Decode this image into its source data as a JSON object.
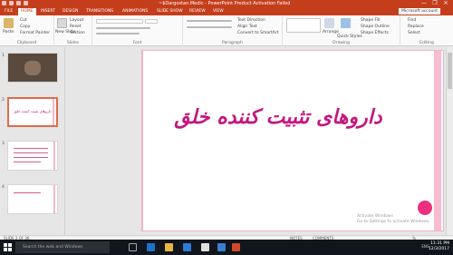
{
  "window": {
    "title": "~$Dargostan.Medic - PowerPoint Product Activation Failed",
    "controls": [
      "—",
      "❐",
      "✕"
    ]
  },
  "ribbon_tabs": [
    {
      "label": "FILE",
      "active": false
    },
    {
      "label": "HOME",
      "active": true
    },
    {
      "label": "INSERT",
      "active": false
    },
    {
      "label": "DESIGN",
      "active": false
    },
    {
      "label": "TRANSITIONS",
      "active": false
    },
    {
      "label": "ANIMATIONS",
      "active": false
    },
    {
      "label": "SLIDE SHOW",
      "active": false
    },
    {
      "label": "REVIEW",
      "active": false
    },
    {
      "label": "VIEW",
      "active": false
    }
  ],
  "account": "Microsoft account",
  "ribbon_groups": {
    "clipboard": {
      "label": "Clipboard",
      "items": [
        "Paste",
        "Cut",
        "Copy",
        "Format Painter"
      ]
    },
    "slides": {
      "label": "Slides",
      "items": [
        "New Slide",
        "Layout",
        "Reset",
        "Section"
      ]
    },
    "font": {
      "label": "Font"
    },
    "paragraph": {
      "label": "Paragraph",
      "items": [
        "Text Direction",
        "Align Text",
        "Convert to SmartArt"
      ]
    },
    "drawing": {
      "label": "Drawing",
      "items": [
        "Arrange",
        "Quick Styles",
        "Shape Fill",
        "Shape Outline",
        "Shape Effects"
      ]
    },
    "editing": {
      "label": "Editing",
      "items": [
        "Find",
        "Replace",
        "Select"
      ]
    }
  },
  "thumbnails": [
    {
      "num": "1"
    },
    {
      "num": "2",
      "text": "داروهای تثبیت کننده خلق"
    },
    {
      "num": "3"
    },
    {
      "num": "4"
    }
  ],
  "slide": {
    "title": "داروهای تثبیت کننده خلق"
  },
  "watermark": {
    "line1": "Activate Windows",
    "line2": "Go to Settings to activate Windows."
  },
  "status": {
    "slide_info": "SLIDE 2 OF 36",
    "notes": "NOTES",
    "comments": "COMMENTS",
    "zoom": "%"
  },
  "taskbar": {
    "search_placeholder": "Search the web and Windows",
    "time": "11:31 PM",
    "date": "12/3/2017",
    "tray_text": "ENG"
  },
  "colors": {
    "brand": "#c43e1c",
    "title_text": "#c41680",
    "accent_pink": "#ec2f7d",
    "stripe": "#f8bcd0"
  }
}
